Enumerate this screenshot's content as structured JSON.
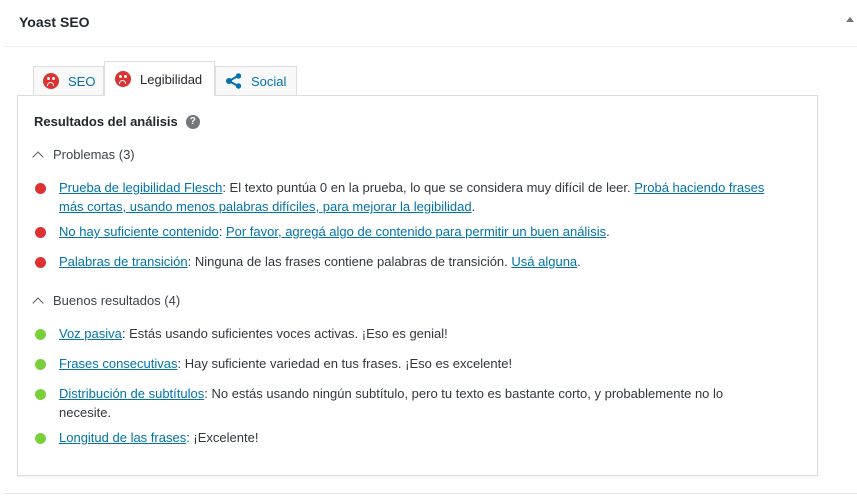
{
  "metabox": {
    "title": "Yoast SEO"
  },
  "tabs": [
    {
      "label": "SEO",
      "icon": "sad-face-icon",
      "status_color": "#dc3232"
    },
    {
      "label": "Legibilidad",
      "icon": "sad-face-icon",
      "status_color": "#dc3232",
      "active": true
    },
    {
      "label": "Social",
      "icon": "share-icon"
    }
  ],
  "analysis": {
    "title": "Resultados del análisis",
    "help": "?",
    "problems": {
      "heading": "Problemas (3)",
      "items": [
        {
          "link": "Prueba de legibilidad Flesch",
          "text": ": El texto puntúa 0 en la prueba, lo que se considera muy difícil de leer. ",
          "action": "Probá haciendo frases más cortas, usando menos palabras difíciles, para mejorar la legibilidad",
          "end": "."
        },
        {
          "link": "No hay suficiente contenido",
          "text": ": ",
          "action": "Por favor, agregá algo de contenido para permitir un buen análisis",
          "end": "."
        },
        {
          "link": "Palabras de transición",
          "text": ": Ninguna de las frases contiene palabras de transición. ",
          "action": "Usá alguna",
          "end": "."
        }
      ]
    },
    "good": {
      "heading": "Buenos resultados (4)",
      "items": [
        {
          "link": "Voz pasiva",
          "text": ": Estás usando suficientes voces activas. ¡Eso es genial!"
        },
        {
          "link": "Frases consecutivas",
          "text": ": Hay suficiente variedad en tus frases. ¡Eso es excelente!"
        },
        {
          "link": "Distribución de subtítulos",
          "text": ": No estás usando ningún subtítulo, pero tu texto es bastante corto, y probablemente no lo necesite."
        },
        {
          "link": "Longitud de las frases",
          "text": ": ¡Excelente!"
        }
      ]
    }
  },
  "colors": {
    "bad": "#dc3232",
    "good": "#7ad03a",
    "link": "#0073aa"
  }
}
